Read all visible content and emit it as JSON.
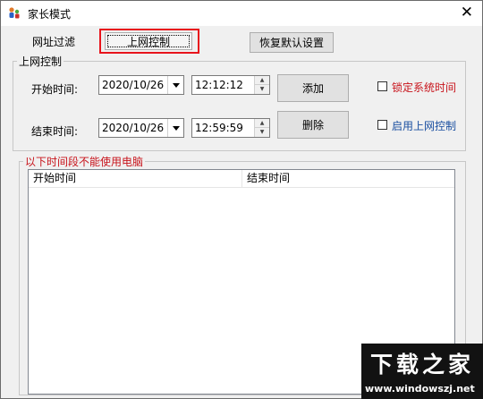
{
  "window": {
    "title": "家长模式",
    "close_glyph": "✕",
    "icon": "family-app-icon"
  },
  "tabs": [
    {
      "label": "网址过滤",
      "selected": false
    },
    {
      "label": "上网控制",
      "selected": true
    }
  ],
  "restore_defaults_label": "恢复默认设置",
  "control_group": {
    "title": "上网控制",
    "start_label": "开始时间:",
    "end_label": "结束时间:",
    "start_date": "2020/10/26",
    "start_time": "12:12:12",
    "end_date": "2020/10/26",
    "end_time": "12:59:59",
    "add_label": "添加",
    "delete_label": "删除",
    "lock_time_label": "锁定系统时间",
    "lock_time_checked": false,
    "enable_control_label": "启用上网控制",
    "enable_control_checked": false
  },
  "blocked_group": {
    "title": "以下时间段不能使用电脑",
    "columns": [
      "开始时间",
      "结束时间"
    ],
    "rows": []
  },
  "watermark": {
    "logo_text": "下载之家",
    "url": "www.windowszj.net"
  },
  "colors": {
    "highlight": "#e8141c",
    "red_text": "#c8141c",
    "blue_text": "#1a4fa0"
  }
}
